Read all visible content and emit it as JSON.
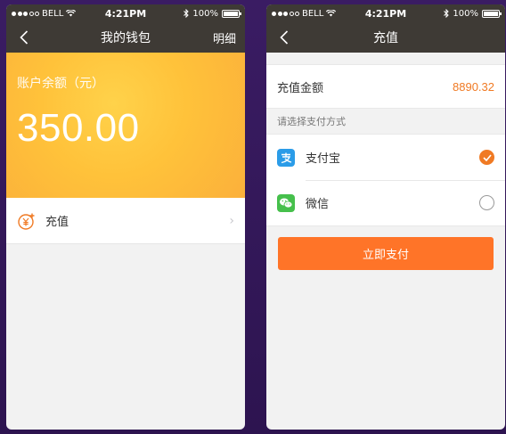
{
  "status_bar": {
    "carrier": "BELL",
    "time": "4:21PM",
    "battery": "100%",
    "signal_bars_filled": 3,
    "signal_bars_total": 5
  },
  "wallet_screen": {
    "title": "我的钱包",
    "right_action": "明细",
    "balance_label": "账户余额（元）",
    "balance_amount": "350.00",
    "menu_items": [
      {
        "label": "充值",
        "icon": "yuan-plus-icon"
      }
    ]
  },
  "recharge_screen": {
    "title": "充值",
    "amount_label": "充值金额",
    "amount_value": "8890.32",
    "payment_section_label": "请选择支付方式",
    "payment_methods": [
      {
        "label": "支付宝",
        "icon": "alipay-icon",
        "selected": true
      },
      {
        "label": "微信",
        "icon": "wechat-icon",
        "selected": false
      }
    ],
    "pay_button_label": "立即支付"
  },
  "colors": {
    "accent": "#f07a24",
    "pay_button": "#ff7428",
    "nav_bar": "#3e3a35",
    "balance_card": "#fbb03b",
    "alipay_blue": "#2b9ce8",
    "wechat_green": "#46c04c",
    "background": "#3a1c63"
  }
}
